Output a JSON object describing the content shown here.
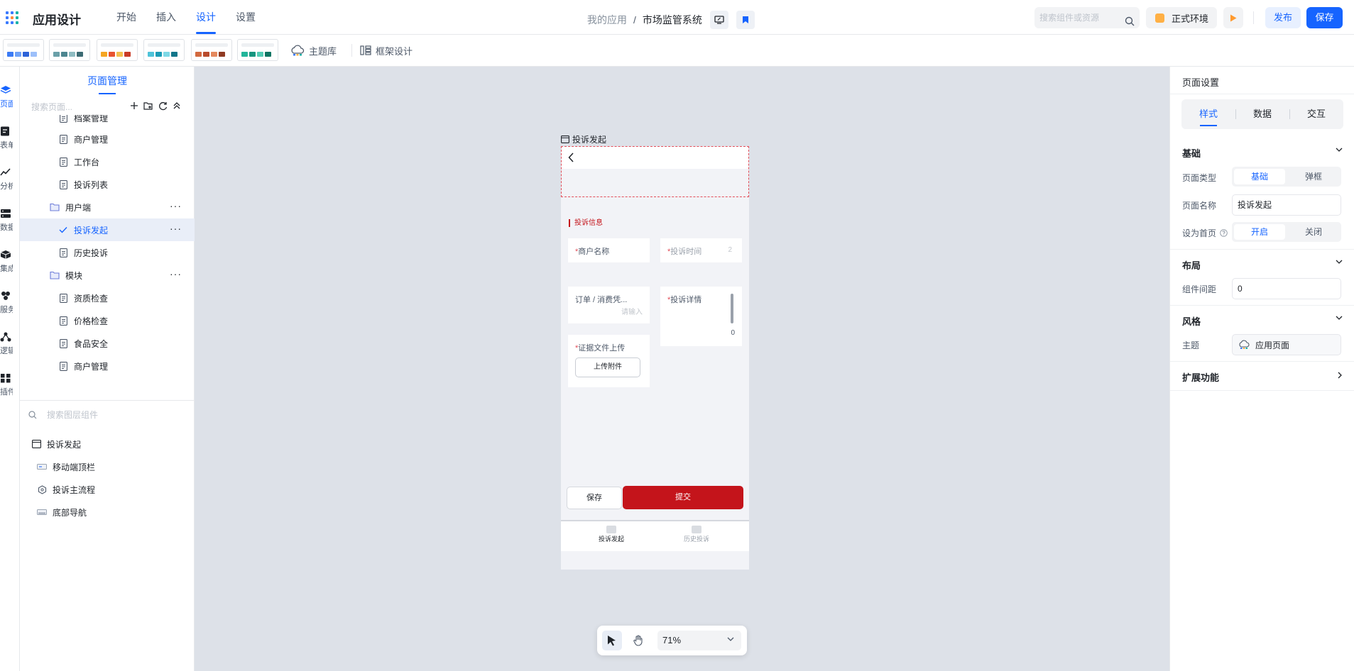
{
  "header": {
    "app_title": "应用设计",
    "tabs": [
      {
        "label": "开始"
      },
      {
        "label": "插入"
      },
      {
        "label": "设计"
      },
      {
        "label": "设置"
      }
    ],
    "breadcrumb": {
      "root": "我的应用",
      "separator": "/",
      "current": "市场监管系统"
    },
    "search_placeholder": "搜索组件或资源",
    "env_label": "正式环境",
    "publish_label": "发布",
    "save_label": "保存",
    "accent_color": "#1664ff"
  },
  "toolbar": {
    "themes": [
      {
        "colors": [
          "#3b7bf5",
          "#6fa2f7",
          "#2d63d8",
          "#9dc0fa"
        ]
      },
      {
        "colors": [
          "#6aa0a8",
          "#4d8690",
          "#8fbcc2",
          "#3c6b73"
        ]
      },
      {
        "colors": [
          "#f5a623",
          "#e8542f",
          "#f4c04f",
          "#c93b27"
        ]
      },
      {
        "colors": [
          "#4fc3d9",
          "#1a9bb5",
          "#7dd8e6",
          "#12768a"
        ]
      },
      {
        "colors": [
          "#d2693f",
          "#b94b2c",
          "#e58a5f",
          "#8f3a22"
        ]
      },
      {
        "colors": [
          "#22b59a",
          "#16957f",
          "#53ccb5",
          "#0f7563"
        ]
      }
    ],
    "theme_library_label": "主题库",
    "frame_design_label": "框架设计"
  },
  "rail": {
    "items": [
      {
        "label": "页面",
        "icon": "layers-icon"
      },
      {
        "label": "表单",
        "icon": "form-icon"
      },
      {
        "label": "分析",
        "icon": "chart-icon"
      },
      {
        "label": "数据",
        "icon": "database-icon"
      },
      {
        "label": "集成",
        "icon": "box-icon"
      },
      {
        "label": "服务",
        "icon": "hexagon-icon"
      },
      {
        "label": "逻辑",
        "icon": "flow-icon"
      },
      {
        "label": "插件",
        "icon": "plugin-icon"
      }
    ]
  },
  "pages": {
    "tab_label": "页面管理",
    "search_placeholder": "搜索页面...",
    "tree": [
      {
        "label": "档案管理",
        "type": "page",
        "level": 2
      },
      {
        "label": "商户管理",
        "type": "page",
        "level": 2
      },
      {
        "label": "工作台",
        "type": "page",
        "level": 2
      },
      {
        "label": "投诉列表",
        "type": "page",
        "level": 2
      },
      {
        "label": "用户端",
        "type": "folder",
        "level": 1
      },
      {
        "label": "投诉发起",
        "type": "page",
        "level": 2,
        "selected": true
      },
      {
        "label": "历史投诉",
        "type": "page",
        "level": 2
      },
      {
        "label": "模块",
        "type": "folder",
        "level": 1
      },
      {
        "label": "资质检查",
        "type": "page",
        "level": 2
      },
      {
        "label": "价格检查",
        "type": "page",
        "level": 2
      },
      {
        "label": "食品安全",
        "type": "page",
        "level": 2
      },
      {
        "label": "商户管理",
        "type": "page",
        "level": 2
      }
    ],
    "more_glyph": "···",
    "layers_search_placeholder": "搜索图层组件",
    "layers": [
      {
        "label": "投诉发起",
        "icon": "page-frame-icon"
      },
      {
        "label": "移动端顶栏",
        "icon": "topbar-icon"
      },
      {
        "label": "投诉主流程",
        "icon": "flow-hex-icon"
      },
      {
        "label": "底部导航",
        "icon": "bottom-nav-icon"
      }
    ]
  },
  "canvas": {
    "frame_title": "投诉发起",
    "section_title": "投诉信息",
    "fields": {
      "merchant": {
        "label": "商户名称",
        "required": "*"
      },
      "time": {
        "label": "投诉时间",
        "required": "*",
        "hint": "2"
      },
      "order": {
        "label": "订单 / 消费凭...",
        "placeholder": "请输入"
      },
      "detail": {
        "label": "投诉详情",
        "required": "*",
        "counter": "0"
      },
      "evidence": {
        "label": "证据文件上传",
        "required": "*",
        "button": "上传附件"
      }
    },
    "save_button": "保存",
    "submit_button": "提交",
    "brand_red": "#c4141b",
    "tabbar": [
      {
        "label": "投诉发起"
      },
      {
        "label": "历史投诉"
      }
    ],
    "zoom": "71%"
  },
  "props": {
    "title": "页面设置",
    "tabs": [
      {
        "label": "样式"
      },
      {
        "label": "数据"
      },
      {
        "label": "交互"
      }
    ],
    "basic": {
      "title": "基础",
      "page_type_label": "页面类型",
      "page_type_options": [
        "基础",
        "弹框"
      ],
      "page_name_label": "页面名称",
      "page_name_value": "投诉发起",
      "home_label": "设为首页",
      "home_options": [
        "开启",
        "关闭"
      ]
    },
    "layout": {
      "title": "布局",
      "gap_label": "组件间距",
      "gap_value": "0"
    },
    "style": {
      "title": "风格",
      "theme_label": "主题",
      "theme_value": "应用页面"
    },
    "extensions_title": "扩展功能"
  }
}
